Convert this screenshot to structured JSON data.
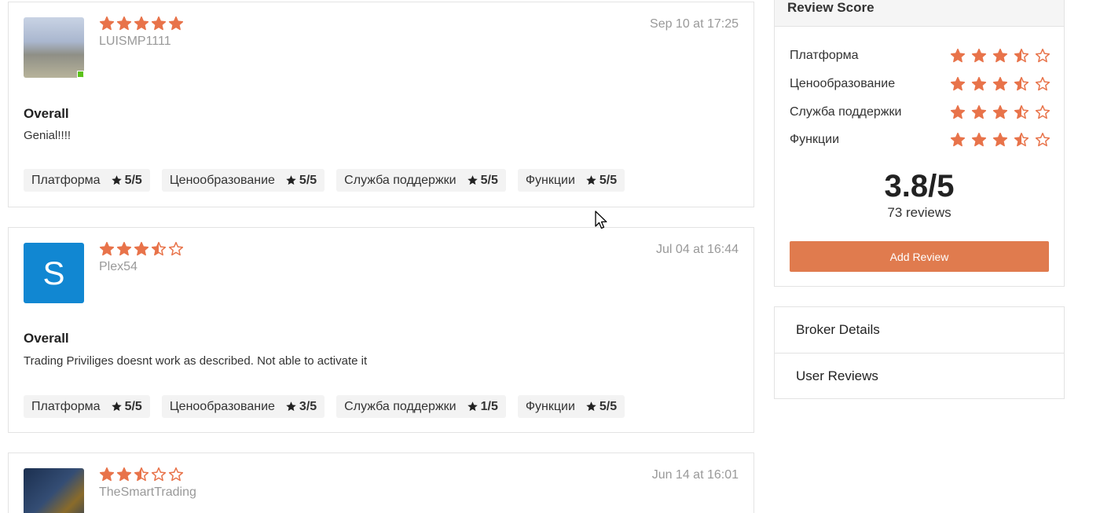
{
  "colors": {
    "star": "#e8734a",
    "star_outline": "#e8734a",
    "accent_button": "#e07b4e",
    "online": "#5cc21a",
    "avatar_blue": "#1187d2"
  },
  "reviews": [
    {
      "avatar_type": "photo-city",
      "avatar_letter": "",
      "online": true,
      "rating": 5,
      "username": "LUISMP1111",
      "date": "Sep 10 at 17:25",
      "overall_label": "Overall",
      "text": "Genial!!!!",
      "tags": [
        {
          "label": "Платформа",
          "value": "5/5"
        },
        {
          "label": "Ценообразование",
          "value": "5/5"
        },
        {
          "label": "Служба поддержки",
          "value": "5/5"
        },
        {
          "label": "Функции",
          "value": "5/5"
        }
      ]
    },
    {
      "avatar_type": "letter",
      "avatar_letter": "S",
      "online": false,
      "rating": 3.5,
      "username": "Plex54",
      "date": "Jul 04 at 16:44",
      "overall_label": "Overall",
      "text": "Trading Priviliges doesnt work as described. Not able to activate it",
      "tags": [
        {
          "label": "Платформа",
          "value": "5/5"
        },
        {
          "label": "Ценообразование",
          "value": "3/5"
        },
        {
          "label": "Служба поддержки",
          "value": "1/5"
        },
        {
          "label": "Функции",
          "value": "5/5"
        }
      ]
    },
    {
      "avatar_type": "photo-coins",
      "avatar_letter": "",
      "online": false,
      "rating": 2.5,
      "username": "TheSmartTrading",
      "date": "Jun 14 at 16:01",
      "overall_label": "",
      "text": "",
      "tags": []
    }
  ],
  "score_panel": {
    "title": "Review Score",
    "rows": [
      {
        "label": "Платформа",
        "rating": 3.5
      },
      {
        "label": "Ценообразование",
        "rating": 3.5
      },
      {
        "label": "Служба поддержки",
        "rating": 3.5
      },
      {
        "label": "Функции",
        "rating": 3.5
      }
    ],
    "score": "3.8/5",
    "count": "73 reviews",
    "button_label": "Add Review"
  },
  "nav": [
    {
      "label": "Broker Details"
    },
    {
      "label": "User Reviews"
    }
  ]
}
